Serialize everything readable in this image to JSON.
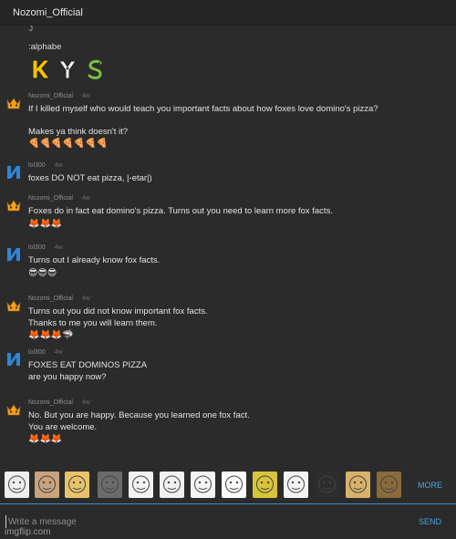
{
  "header": {
    "title": "Nozomi_Official"
  },
  "chat": {
    "leftover_text": "J",
    "command_text": ":alphabe",
    "glyph_icons": [
      "yellow-K-letter-icon",
      "white-Y-letter-icon",
      "green-S-snake-letter-icon"
    ],
    "messages": [
      {
        "user": "Nozomi_Official",
        "avatar": "crown-avatar-icon",
        "time": "4w",
        "lines": [
          "If I killed myself who would teach you important facts about how foxes love domino's pizza?",
          "",
          "Makes ya think doesn't it?"
        ],
        "emojis": "🍕🍕🍕🍕🍕🍕🍕"
      },
      {
        "user": "lol300",
        "avatar": "blue-n-avatar-icon",
        "time": "4w",
        "lines": [
          "foxes DO NOT eat pizza, |-etar|)"
        ],
        "emojis": ""
      },
      {
        "user": "Nozomi_Official",
        "avatar": "crown-avatar-icon",
        "time": "4w",
        "lines": [
          "Foxes do in fact eat domino's pizza. Turns out you need to learn more fox facts."
        ],
        "emojis": "🦊🦊🦊"
      },
      {
        "user": "lol300",
        "avatar": "blue-n-avatar-icon",
        "time": "4w",
        "lines": [
          "Turns out I already know fox facts."
        ],
        "emojis": "😎😎😎"
      },
      {
        "user": "Nozomi_Official",
        "avatar": "crown-avatar-icon",
        "time": "4w",
        "lines": [
          "Turns out you did not know important fox facts.",
          "Thanks to me you will learn them."
        ],
        "emojis": "🦊🦊🦊🦈"
      },
      {
        "user": "lol300",
        "avatar": "blue-n-avatar-icon",
        "time": "4w",
        "lines": [
          "FOXES EAT DOMINOS PIZZA",
          "are you happy now?"
        ],
        "emojis": ""
      },
      {
        "user": "Nozomi_Official",
        "avatar": "crown-avatar-icon",
        "time": "4w",
        "lines": [
          "No. But you are happy. Because you learned one fox fact.",
          "You are welcome."
        ],
        "emojis": "🦊🦊🦊"
      }
    ]
  },
  "meme_bar": {
    "memes": [
      "troll-face-meme-icon",
      "jesus-meme-icon",
      "cat-meme-icon",
      "deal-with-it-glasses-meme-icon",
      "sad-face-meme-icon",
      "rage-face-meme-icon",
      "happy-rage-face-meme-icon",
      "sketch-face-meme-icon",
      "spongebob-meme-icon",
      "derp-face-meme-icon",
      "caution-sign-meme-icon",
      "doge-meme-icon",
      "leonardo-toast-meme-icon"
    ],
    "more_label": "MORE"
  },
  "composer": {
    "placeholder": "Write a message",
    "value": "",
    "send_label": "SEND"
  },
  "watermark": "imgflip.com",
  "colors": {
    "background": "#2b2b2b",
    "accent_blue": "#4aa3df",
    "divider_blue": "#3a8fd0",
    "crown_orange": "#f0a020",
    "lol300_blue": "#2f86d6"
  }
}
